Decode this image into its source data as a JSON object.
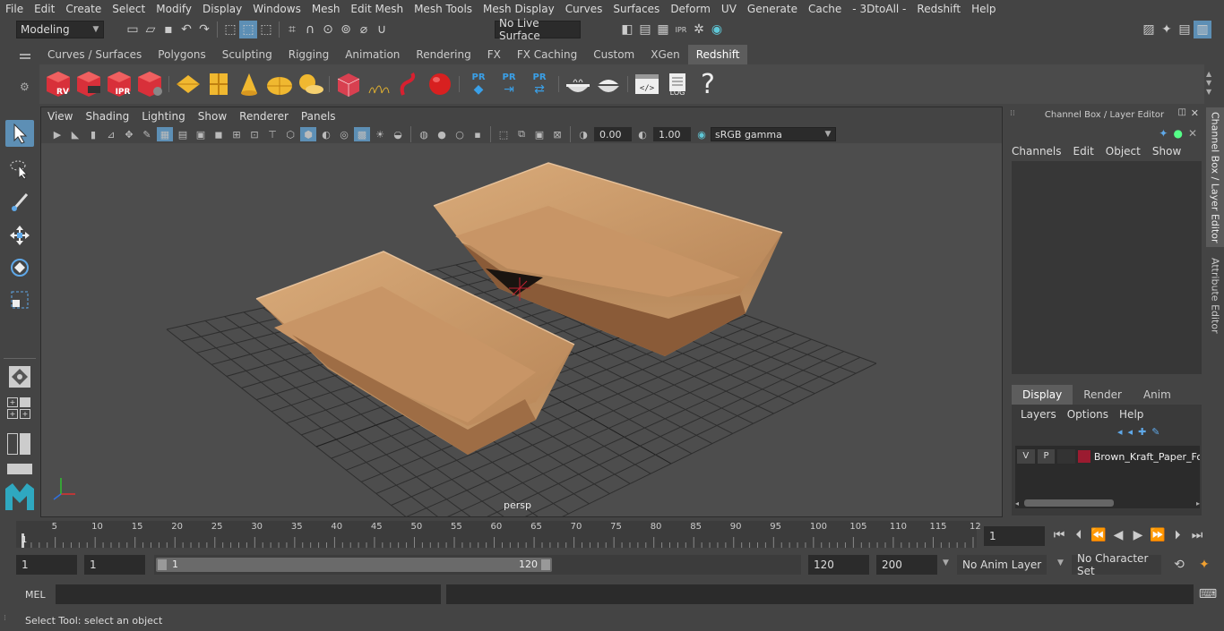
{
  "menu": [
    "File",
    "Edit",
    "Create",
    "Select",
    "Modify",
    "Display",
    "Windows",
    "Mesh",
    "Edit Mesh",
    "Mesh Tools",
    "Mesh Display",
    "Curves",
    "Surfaces",
    "Deform",
    "UV",
    "Generate",
    "Cache",
    "- 3DtoAll -",
    "Redshift",
    "Help"
  ],
  "status": {
    "mode": "Modeling",
    "live_surface": "No Live Surface"
  },
  "shelf_tabs": [
    "Curves / Surfaces",
    "Polygons",
    "Sculpting",
    "Rigging",
    "Animation",
    "Rendering",
    "FX",
    "FX Caching",
    "Custom",
    "XGen",
    "Redshift"
  ],
  "shelf_active": "Redshift",
  "shelf_labels": {
    "rv": "RV",
    "ipr": "IPR",
    "pr1": "PR",
    "pr2": "PR",
    "pr3": "PR",
    "log": "LOG",
    "help": "?"
  },
  "viewport": {
    "menu": [
      "View",
      "Shading",
      "Lighting",
      "Show",
      "Renderer",
      "Panels"
    ],
    "exposure": "0.00",
    "gamma": "1.00",
    "color_space": "sRGB gamma",
    "camera_label": "persp"
  },
  "channel_box": {
    "title": "Channel Box / Layer Editor",
    "menu": [
      "Channels",
      "Edit",
      "Object",
      "Show"
    ],
    "layer_tabs": [
      "Display",
      "Render",
      "Anim"
    ],
    "layer_menu": [
      "Layers",
      "Options",
      "Help"
    ],
    "layer": {
      "v": "V",
      "p": "P",
      "name": "Brown_Kraft_Paper_Fo",
      "color": "#9b1b30"
    }
  },
  "side_tabs": [
    "Channel Box / Layer Editor",
    "Attribute Editor"
  ],
  "timeline": {
    "ticks": [
      "5",
      "10",
      "15",
      "20",
      "25",
      "30",
      "35",
      "40",
      "45",
      "50",
      "55",
      "60",
      "65",
      "70",
      "75",
      "80",
      "85",
      "90",
      "95",
      "100",
      "105",
      "110",
      "115",
      "12"
    ],
    "start_marker": "1",
    "current_frame": "1"
  },
  "range": {
    "start": "1",
    "playback_start": "1",
    "slider_start": "1",
    "slider_end": "120",
    "playback_end": "120",
    "end": "200",
    "anim_layer": "No Anim Layer",
    "char_set": "No Character Set"
  },
  "mel": {
    "label": "MEL"
  },
  "help_line": "Select Tool: select an object",
  "colors": {
    "accent": "#5d8fb5",
    "kraft": "#c89a6a",
    "layer": "#9b1b30"
  }
}
